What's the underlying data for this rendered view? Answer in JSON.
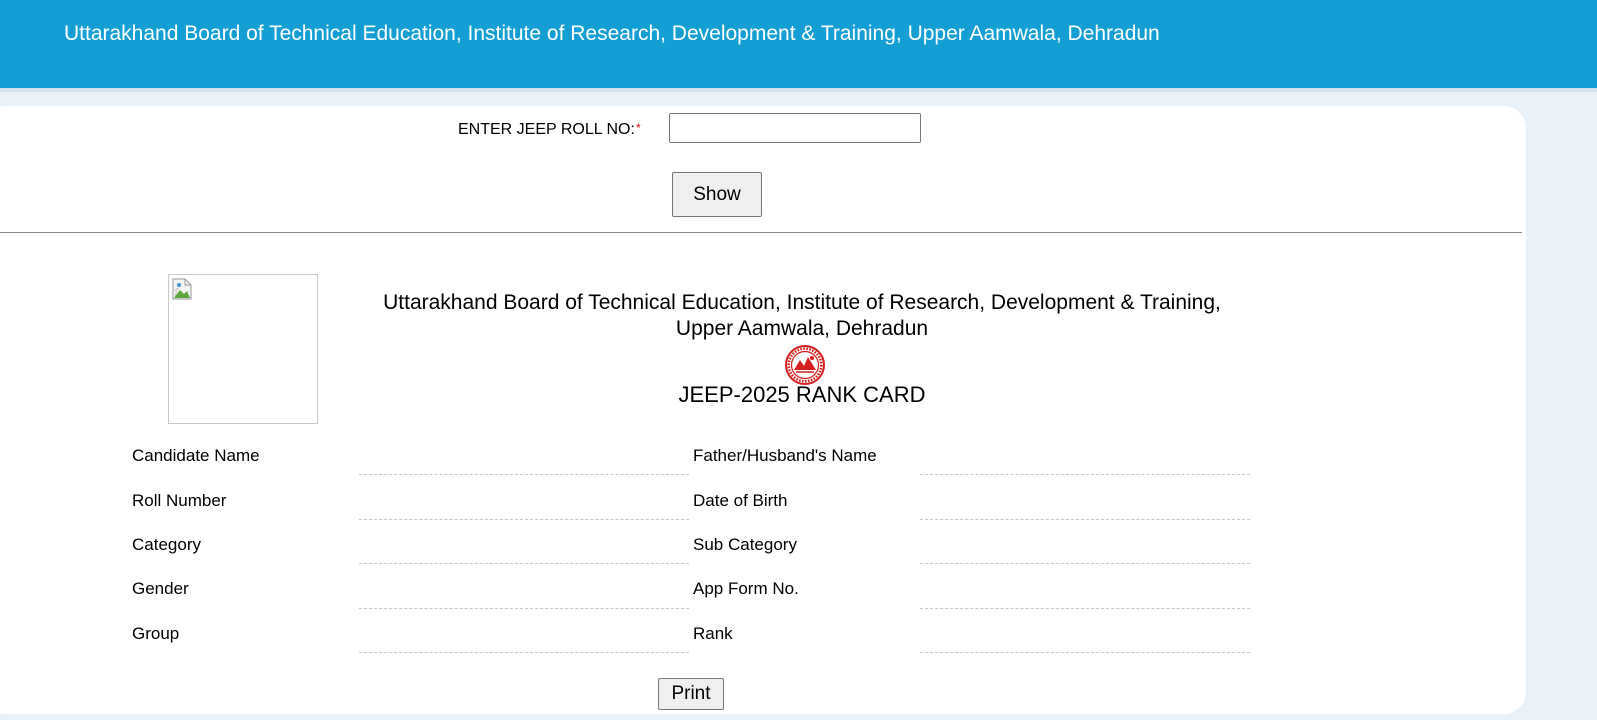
{
  "header": {
    "title": "Uttarakhand Board of Technical Education, Institute of Research, Development & Training, Upper Aamwala, Dehradun"
  },
  "search": {
    "label": "ENTER JEEP ROLL NO:",
    "required_marker": "*",
    "value": "",
    "placeholder": "",
    "show_label": "Show"
  },
  "card": {
    "photo_icon": "broken-image-icon",
    "org_name": "Uttarakhand Board of Technical Education, Institute of Research, Development & Training, Upper Aamwala, Dehradun",
    "seal_icon": "board-seal-icon",
    "subtitle": "JEEP-2025 RANK CARD",
    "fields": {
      "candidate_name": {
        "label": "Candidate Name",
        "value": ""
      },
      "father_husband_name": {
        "label": "Father/Husband's Name",
        "value": ""
      },
      "roll_number": {
        "label": "Roll Number",
        "value": ""
      },
      "date_of_birth": {
        "label": "Date of Birth",
        "value": ""
      },
      "category": {
        "label": "Category",
        "value": ""
      },
      "sub_category": {
        "label": "Sub Category",
        "value": ""
      },
      "gender": {
        "label": "Gender",
        "value": ""
      },
      "app_form_no": {
        "label": "App Form No.",
        "value": ""
      },
      "group": {
        "label": "Group",
        "value": ""
      },
      "rank": {
        "label": "Rank",
        "value": ""
      }
    },
    "print_label": "Print"
  },
  "colors": {
    "header_bg": "#139fd3",
    "page_bg": "#e8f1f8",
    "required": "#e00000",
    "seal_red": "#d42020"
  }
}
